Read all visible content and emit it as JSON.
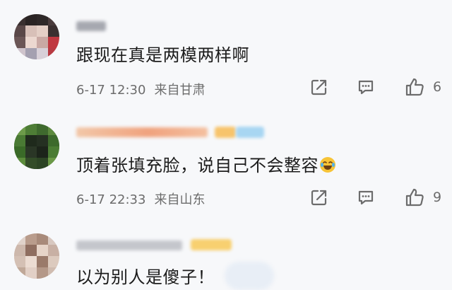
{
  "comments": [
    {
      "text": "跟现在真是两模两样啊",
      "date": "6-17 12:30",
      "location": "来自甘肃",
      "likes": "6"
    },
    {
      "text": "顶着张填充脸，说自己不会整容",
      "emoji": "laughing-tears-emoji",
      "date": "6-17 22:33",
      "location": "来自山东",
      "likes": "9"
    },
    {
      "text": "以为别人是傻子！"
    }
  ],
  "icons": {
    "share": "share-icon",
    "reply": "comment-icon",
    "like": "thumbs-up-icon"
  },
  "colors": {
    "text": "#1c1c1c",
    "meta": "#6c6c6c",
    "background": "#f7f8fa"
  }
}
